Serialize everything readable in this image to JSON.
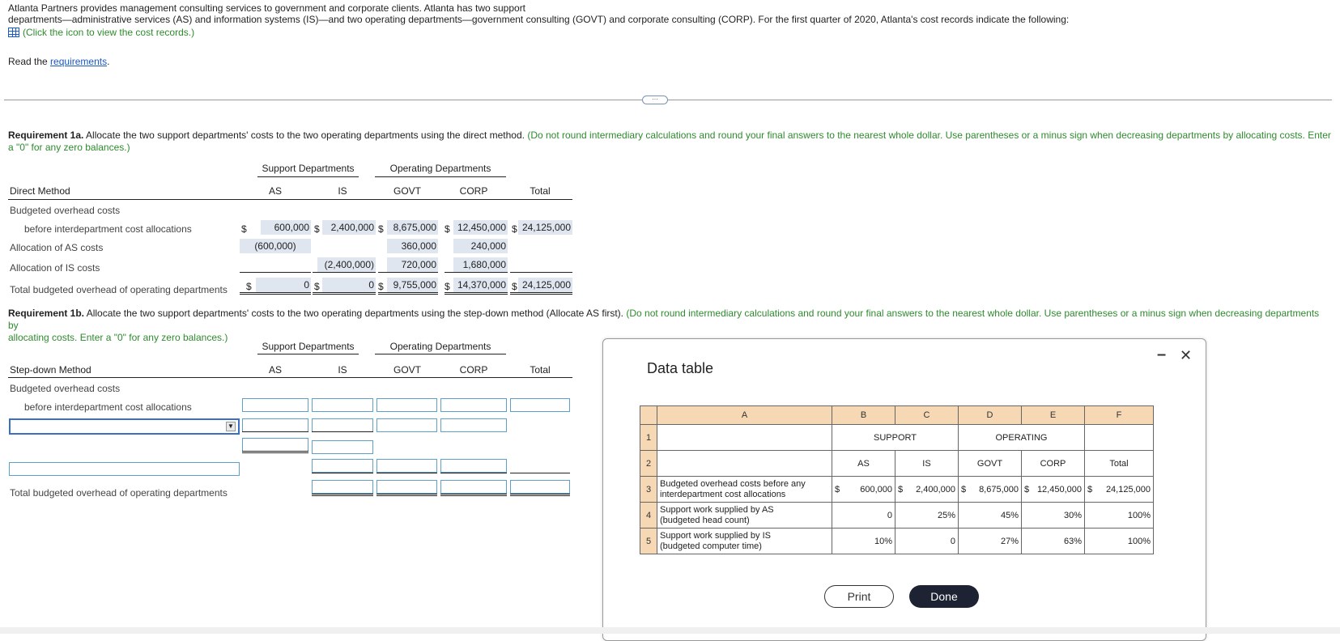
{
  "intro": {
    "line1": "Atlanta Partners provides management consulting services to government and corporate clients. Atlanta has two support",
    "line2": "departments—administrative services (AS) and information systems (IS)—and two operating departments—government consulting (GOVT) and corporate consulting (CORP). For the first quarter of 2020, Atlanta's cost records indicate the following:",
    "icon_link": "(Click the icon to view the cost records.)",
    "read_prefix": "Read the",
    "read_link": "requirements",
    "read_suffix": "."
  },
  "req1a": {
    "bold": "Requirement 1a.",
    "text": " Allocate the two support departments' costs to the two operating departments using the direct method.",
    "note_line1": "(Do not round intermediary calculations and round your final answers to the nearest whole dollar. Use parentheses or a minus sign when decreasing departments by allocating costs. Enter",
    "note_line2": "a \"0\" for any zero balances.)"
  },
  "table_headers": {
    "support": "Support Departments",
    "operating": "Operating Departments",
    "as": "AS",
    "is": "IS",
    "govt": "GOVT",
    "corp": "CORP",
    "total": "Total"
  },
  "direct": {
    "title": "Direct Method",
    "row_budgeted": "Budgeted overhead costs",
    "row_before": "before interdepartment cost allocations",
    "row_alloc_as": "Allocation of AS costs",
    "row_alloc_is": "Allocation of IS costs",
    "row_total": "Total budgeted overhead of operating departments",
    "dollar": "$",
    "before": {
      "as": "600,000",
      "is": "2,400,000",
      "govt": "8,675,000",
      "corp": "12,450,000",
      "total": "24,125,000"
    },
    "alloc_as": {
      "as": "(600,000)",
      "govt": "360,000",
      "corp": "240,000"
    },
    "alloc_is": {
      "is": "(2,400,000)",
      "govt": "720,000",
      "corp": "1,680,000"
    },
    "totals": {
      "as": "0",
      "is": "0",
      "govt": "9,755,000",
      "corp": "14,370,000",
      "total": "24,125,000"
    }
  },
  "req1b": {
    "bold": "Requirement 1b.",
    "text": " Allocate the two support departments' costs to the two operating departments using the step-down method (Allocate AS first).",
    "note_line1": "(Do not round intermediary calculations and round your final answers to the nearest whole dollar. Use parentheses or a minus sign when decreasing departments by",
    "note_line2": "allocating costs. Enter a \"0\" for any zero balances.)"
  },
  "stepdown": {
    "title": "Step-down Method",
    "row_budgeted": "Budgeted overhead costs",
    "row_before": "before interdepartment cost allocations",
    "row_total": "Total budgeted overhead of operating departments"
  },
  "modal": {
    "title": "Data table",
    "minimize": "–",
    "close": "✕",
    "col_letters": [
      "A",
      "B",
      "C",
      "D",
      "E",
      "F"
    ],
    "row1": {
      "support": "SUPPORT",
      "operating": "OPERATING"
    },
    "row2": {
      "as": "AS",
      "is": "IS",
      "govt": "GOVT",
      "corp": "CORP",
      "total": "Total"
    },
    "row3": {
      "label1": "Budgeted overhead costs before any",
      "label2": "interdepartment cost allocations",
      "dollar": "$",
      "as": "600,000",
      "is": "2,400,000",
      "govt": "8,675,000",
      "corp": "12,450,000",
      "total": "24,125,000"
    },
    "row4": {
      "label1": "Support work supplied by AS",
      "label2": "(budgeted head count)",
      "as": "0",
      "is": "25%",
      "govt": "45%",
      "corp": "30%",
      "total": "100%"
    },
    "row5": {
      "label1": "Support work supplied by IS",
      "label2": "(budgeted computer time)",
      "as": "10%",
      "is": "0",
      "govt": "27%",
      "corp": "63%",
      "total": "100%"
    },
    "rownums": [
      "1",
      "2",
      "3",
      "4",
      "5"
    ],
    "print": "Print",
    "done": "Done"
  },
  "colors": {
    "accent": "#1a57c8",
    "green": "#2e8b2e",
    "input_border": "#5fa0c8",
    "shade": "#dfe6ef",
    "header_fill": "#f7d8b5"
  }
}
